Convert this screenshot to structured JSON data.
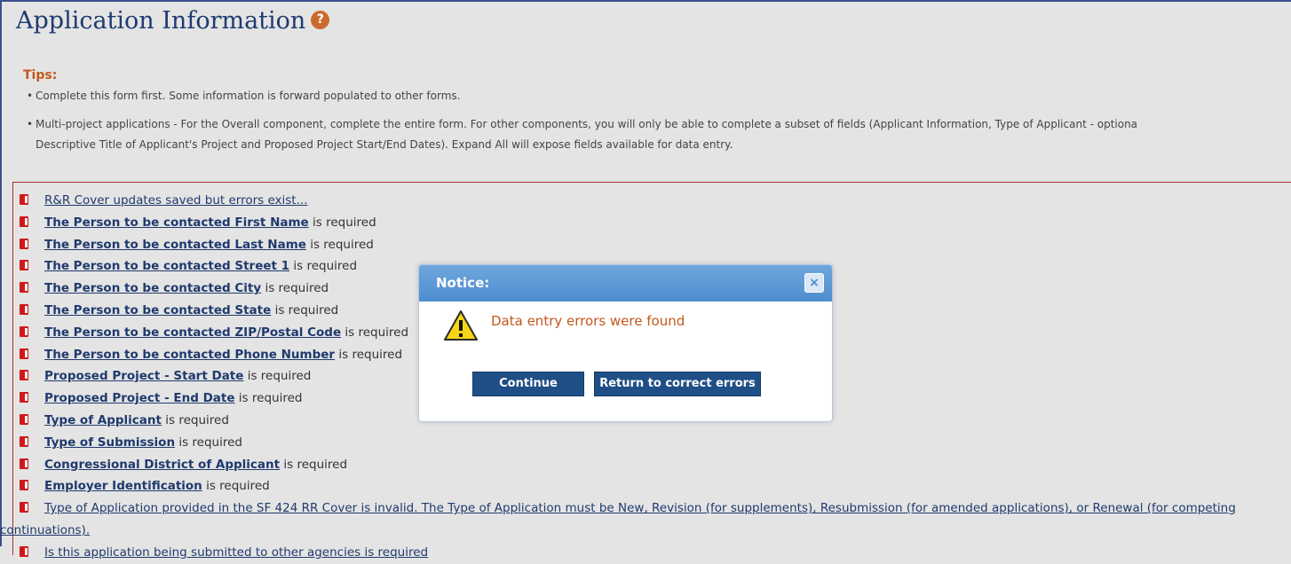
{
  "header": {
    "title": "Application Information",
    "help_icon": "?"
  },
  "tips": {
    "label": "Tips:",
    "items": [
      "Complete this form first. Some information is forward populated to other forms.",
      "Multi-project applications - For the Overall component, complete the entire form. For other components, you will only be able to complete a subset of fields (Applicant Information, Type of Applicant - optiona",
      "Descriptive Title of Applicant's Project and Proposed Project Start/End Dates). Expand All will expose fields available for data entry."
    ]
  },
  "errors": {
    "summary": "R&R Cover updates saved but errors exist...",
    "items": [
      {
        "field": "The Person to be contacted First Name",
        "suffix": " is required"
      },
      {
        "field": "The Person to be contacted Last Name",
        "suffix": " is required"
      },
      {
        "field": "The Person to be contacted Street 1",
        "suffix": " is required"
      },
      {
        "field": "The Person to be contacted City",
        "suffix": " is required"
      },
      {
        "field": "The Person to be contacted State",
        "suffix": " is required"
      },
      {
        "field": "The Person to be contacted ZIP/Postal Code",
        "suffix": " is required"
      },
      {
        "field": "The Person to be contacted Phone Number",
        "suffix": " is required"
      },
      {
        "field": "Proposed Project - Start Date",
        "suffix": " is required"
      },
      {
        "field": "Proposed Project - End Date",
        "suffix": " is required"
      },
      {
        "field": "Type of Applicant",
        "suffix": " is required"
      },
      {
        "field": "Type of Submission",
        "suffix": " is required"
      },
      {
        "field": "Congressional District of Applicant",
        "suffix": " is required"
      },
      {
        "field": "Employer Identification",
        "suffix": " is required"
      }
    ],
    "long_msg_line1": "Type of Application provided in the SF 424 RR Cover is invalid. The Type of Application must be New, Revision (for supplements), Resubmission (for amended applications), or Renewal (for competing",
    "long_msg_line2": "continuations).",
    "last_item": "Is this application being submitted to other agencies is required"
  },
  "modal": {
    "title": "Notice:",
    "close": "×",
    "message": "Data entry errors were found",
    "continue_label": "Continue",
    "return_label": "Return to correct errors"
  },
  "colors": {
    "title": "#1e3a72",
    "tips": "#c4581d",
    "error_icon": "#d01818",
    "modal_header": "#4d8dcf",
    "button": "#1f4f86"
  },
  "icons": {
    "help": "help-icon",
    "error": "error-flag-icon",
    "warning": "warning-icon",
    "close": "close-icon"
  }
}
